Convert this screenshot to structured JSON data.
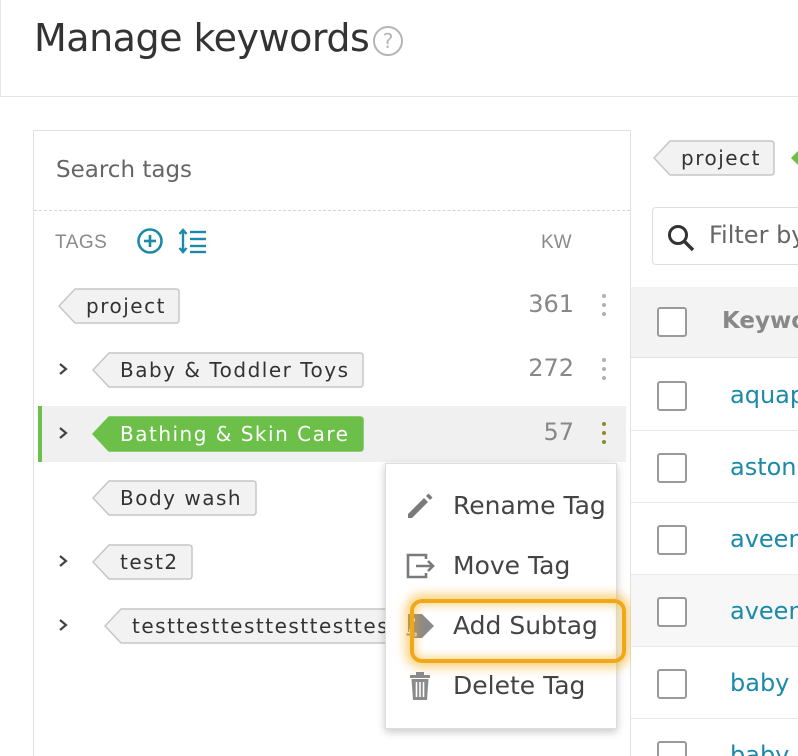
{
  "header": {
    "title": "Manage keywords",
    "help_icon": "question-circle-icon"
  },
  "tags_panel": {
    "search_placeholder": "Search tags",
    "tags_label": "TAGS",
    "kw_label": "KW",
    "tags": [
      {
        "name": "project",
        "count": "361",
        "expandable": false,
        "selected": false
      },
      {
        "name": "Baby & Toddler Toys",
        "count": "272",
        "expandable": true,
        "selected": false
      },
      {
        "name": "Bathing & Skin Care",
        "count": "57",
        "expandable": true,
        "selected": true
      },
      {
        "name": "Body wash",
        "count": "",
        "expandable": false,
        "selected": false
      },
      {
        "name": "test2",
        "count": "",
        "expandable": true,
        "selected": false
      },
      {
        "name": "testtesttesttesttesttestt",
        "count": "",
        "expandable": true,
        "selected": false
      }
    ]
  },
  "context_menu": {
    "items": [
      {
        "label": "Rename Tag",
        "icon": "pencil-icon"
      },
      {
        "label": "Move Tag",
        "icon": "move-icon"
      },
      {
        "label": "Add Subtag",
        "icon": "add-subtag-icon",
        "highlighted": true
      },
      {
        "label": "Delete Tag",
        "icon": "trash-icon"
      }
    ]
  },
  "right_panel": {
    "filter_tag": "project",
    "filter_placeholder": "Filter by",
    "table_header": "Keywo",
    "rows": [
      "aquap",
      "aston",
      "aveen",
      "aveen",
      "baby c",
      "baby c"
    ]
  },
  "colors": {
    "accent_green": "#6cc04a",
    "link_blue": "#1a8aa8",
    "highlight_orange": "#f0a818",
    "icon_teal": "#1a8aa8"
  }
}
